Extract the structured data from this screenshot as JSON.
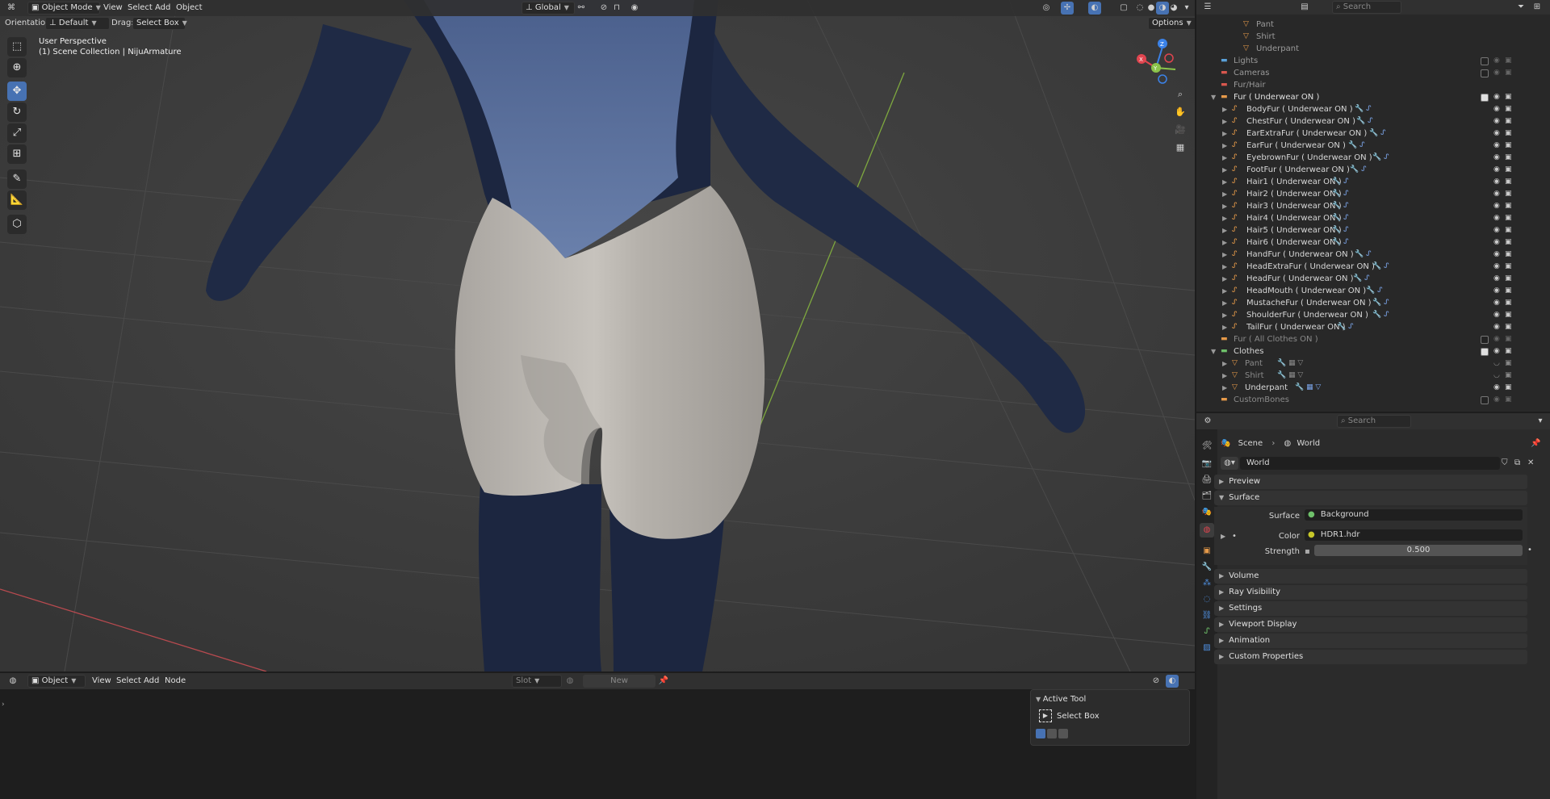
{
  "viewport_header": {
    "mode": "Object Mode",
    "menus": [
      "View",
      "Select",
      "Add",
      "Object"
    ],
    "transform_orientation": "Global",
    "options_label": "Options"
  },
  "tool_header": {
    "orientation_label": "Orientation:",
    "orientation_value": "Default",
    "drag_label": "Drag:",
    "drag_value": "Select Box"
  },
  "viewport": {
    "perspective": "User Perspective",
    "collection_info": "(1) Scene Collection | NijuArmature",
    "gizmo_axes": [
      "X",
      "Y",
      "Z"
    ]
  },
  "node_editor_header": {
    "object_type": "Object",
    "menus": [
      "View",
      "Select",
      "Add",
      "Node"
    ],
    "slot": "Slot",
    "new_button": "New"
  },
  "active_tool_panel": {
    "title": "Active Tool",
    "tool_name": "Select Box"
  },
  "outliner": {
    "search_placeholder": "Search",
    "top_items": [
      "Pant",
      "Shirt",
      "Underpant"
    ],
    "collections": [
      {
        "name": "Lights"
      },
      {
        "name": "Cameras"
      },
      {
        "name": "Fur/Hair"
      },
      {
        "name": "Fur ( Underwear ON )"
      }
    ],
    "fur_items": [
      "BodyFur ( Underwear ON )",
      "ChestFur ( Underwear ON )",
      "EarExtraFur ( Underwear ON )",
      "EarFur ( Underwear ON )",
      "EyebrownFur ( Underwear ON )",
      "FootFur ( Underwear ON )",
      "Hair1 ( Underwear ON )",
      "Hair2 ( Underwear ON )",
      "Hair3 ( Underwear ON )",
      "Hair4 ( Underwear ON )",
      "Hair5 ( Underwear ON )",
      "Hair6 ( Underwear ON )",
      "HandFur ( Underwear ON )",
      "HeadExtraFur ( Underwear ON )",
      "HeadFur ( Underwear ON )",
      "HeadMouth ( Underwear ON )",
      "MustacheFur ( Underwear ON )",
      "ShoulderFur ( Underwear ON )",
      "TailFur ( Underwear ON )"
    ],
    "fur_all_clothes": "Fur ( All Clothes ON )",
    "clothes_collection": "Clothes",
    "clothes_items": [
      "Pant",
      "Shirt",
      "Underpant"
    ],
    "custom_bones": "CustomBones"
  },
  "properties": {
    "search_placeholder": "Search",
    "breadcrumb": [
      "Scene",
      "World"
    ],
    "world_name": "World",
    "panels": [
      "Preview",
      "Surface",
      "Volume",
      "Ray Visibility",
      "Settings",
      "Viewport Display",
      "Animation",
      "Custom Properties"
    ],
    "surface": {
      "surface_label": "Surface",
      "surface_value": "Background",
      "color_label": "Color",
      "color_value": "HDR1.hdr",
      "strength_label": "Strength",
      "strength_value": "0.500"
    }
  },
  "colors": {
    "accent": "#4772b3",
    "x_axis": "#e0454f",
    "y_axis": "#8bc34a",
    "z_axis": "#3b82e8",
    "fur": "#1f2a45",
    "underwear": "#bdb8b2"
  }
}
